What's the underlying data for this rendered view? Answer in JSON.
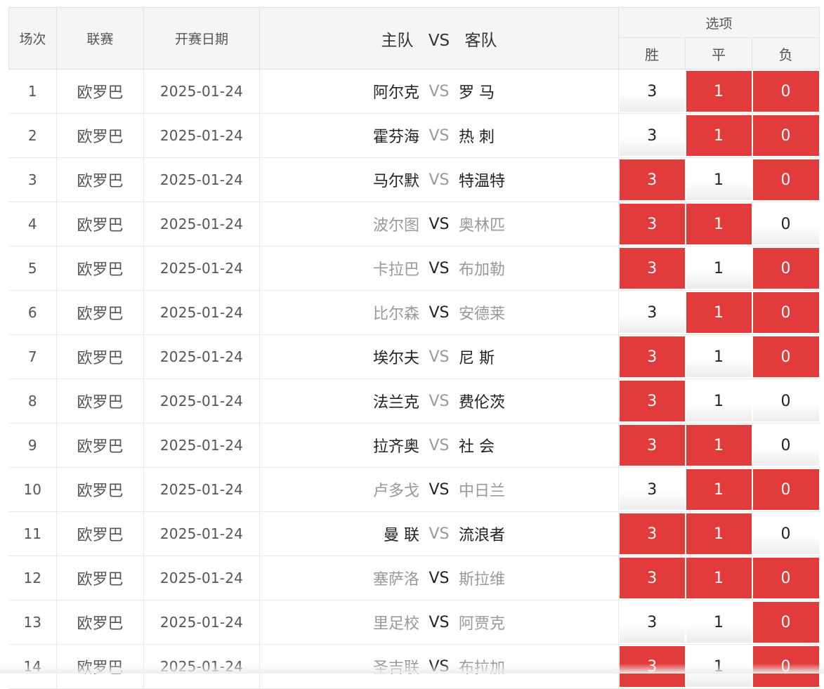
{
  "header": {
    "col_round": "场次",
    "col_league": "联赛",
    "col_date": "开赛日期",
    "col_home": "主队",
    "col_vs": "VS",
    "col_away": "客队",
    "col_options": "选项",
    "opt_win": "胜",
    "opt_draw": "平",
    "opt_loss": "负"
  },
  "colors": {
    "selected": "#e23b3b",
    "muted_team": "#999999"
  },
  "rows": [
    {
      "no": "1",
      "league": "欧罗巴",
      "date": "2025-01-24",
      "home": "阿尔克",
      "away": "罗 马",
      "home_muted": false,
      "away_muted": false,
      "w": "3",
      "d": "1",
      "l": "0",
      "w_on": false,
      "d_on": true,
      "l_on": true
    },
    {
      "no": "2",
      "league": "欧罗巴",
      "date": "2025-01-24",
      "home": "霍芬海",
      "away": "热 刺",
      "home_muted": false,
      "away_muted": false,
      "w": "3",
      "d": "1",
      "l": "0",
      "w_on": false,
      "d_on": true,
      "l_on": true
    },
    {
      "no": "3",
      "league": "欧罗巴",
      "date": "2025-01-24",
      "home": "马尔默",
      "away": "特温特",
      "home_muted": false,
      "away_muted": false,
      "w": "3",
      "d": "1",
      "l": "0",
      "w_on": true,
      "d_on": false,
      "l_on": true
    },
    {
      "no": "4",
      "league": "欧罗巴",
      "date": "2025-01-24",
      "home": "波尔图",
      "away": "奥林匹",
      "home_muted": true,
      "away_muted": true,
      "w": "3",
      "d": "1",
      "l": "0",
      "w_on": true,
      "d_on": true,
      "l_on": false
    },
    {
      "no": "5",
      "league": "欧罗巴",
      "date": "2025-01-24",
      "home": "卡拉巴",
      "away": "布加勒",
      "home_muted": true,
      "away_muted": true,
      "w": "3",
      "d": "1",
      "l": "0",
      "w_on": true,
      "d_on": false,
      "l_on": true
    },
    {
      "no": "6",
      "league": "欧罗巴",
      "date": "2025-01-24",
      "home": "比尔森",
      "away": "安德莱",
      "home_muted": true,
      "away_muted": true,
      "w": "3",
      "d": "1",
      "l": "0",
      "w_on": false,
      "d_on": true,
      "l_on": true
    },
    {
      "no": "7",
      "league": "欧罗巴",
      "date": "2025-01-24",
      "home": "埃尔夫",
      "away": "尼 斯",
      "home_muted": false,
      "away_muted": false,
      "w": "3",
      "d": "1",
      "l": "0",
      "w_on": true,
      "d_on": false,
      "l_on": true
    },
    {
      "no": "8",
      "league": "欧罗巴",
      "date": "2025-01-24",
      "home": "法兰克",
      "away": "费伦茨",
      "home_muted": false,
      "away_muted": false,
      "w": "3",
      "d": "1",
      "l": "0",
      "w_on": true,
      "d_on": false,
      "l_on": false
    },
    {
      "no": "9",
      "league": "欧罗巴",
      "date": "2025-01-24",
      "home": "拉齐奥",
      "away": "社 会",
      "home_muted": false,
      "away_muted": false,
      "w": "3",
      "d": "1",
      "l": "0",
      "w_on": true,
      "d_on": true,
      "l_on": false
    },
    {
      "no": "10",
      "league": "欧罗巴",
      "date": "2025-01-24",
      "home": "卢多戈",
      "away": "中日兰",
      "home_muted": true,
      "away_muted": true,
      "w": "3",
      "d": "1",
      "l": "0",
      "w_on": false,
      "d_on": true,
      "l_on": true
    },
    {
      "no": "11",
      "league": "欧罗巴",
      "date": "2025-01-24",
      "home": "曼 联",
      "away": "流浪者",
      "home_muted": false,
      "away_muted": false,
      "w": "3",
      "d": "1",
      "l": "0",
      "w_on": true,
      "d_on": true,
      "l_on": false
    },
    {
      "no": "12",
      "league": "欧罗巴",
      "date": "2025-01-24",
      "home": "塞萨洛",
      "away": "斯拉维",
      "home_muted": true,
      "away_muted": true,
      "w": "3",
      "d": "1",
      "l": "0",
      "w_on": true,
      "d_on": true,
      "l_on": true
    },
    {
      "no": "13",
      "league": "欧罗巴",
      "date": "2025-01-24",
      "home": "里足校",
      "away": "阿贾克",
      "home_muted": true,
      "away_muted": true,
      "w": "3",
      "d": "1",
      "l": "0",
      "w_on": false,
      "d_on": false,
      "l_on": true
    },
    {
      "no": "14",
      "league": "欧罗巴",
      "date": "2025-01-24",
      "home": "圣吉联",
      "away": "布拉加",
      "home_muted": true,
      "away_muted": true,
      "w": "3",
      "d": "1",
      "l": "0",
      "w_on": true,
      "d_on": false,
      "l_on": true
    }
  ]
}
